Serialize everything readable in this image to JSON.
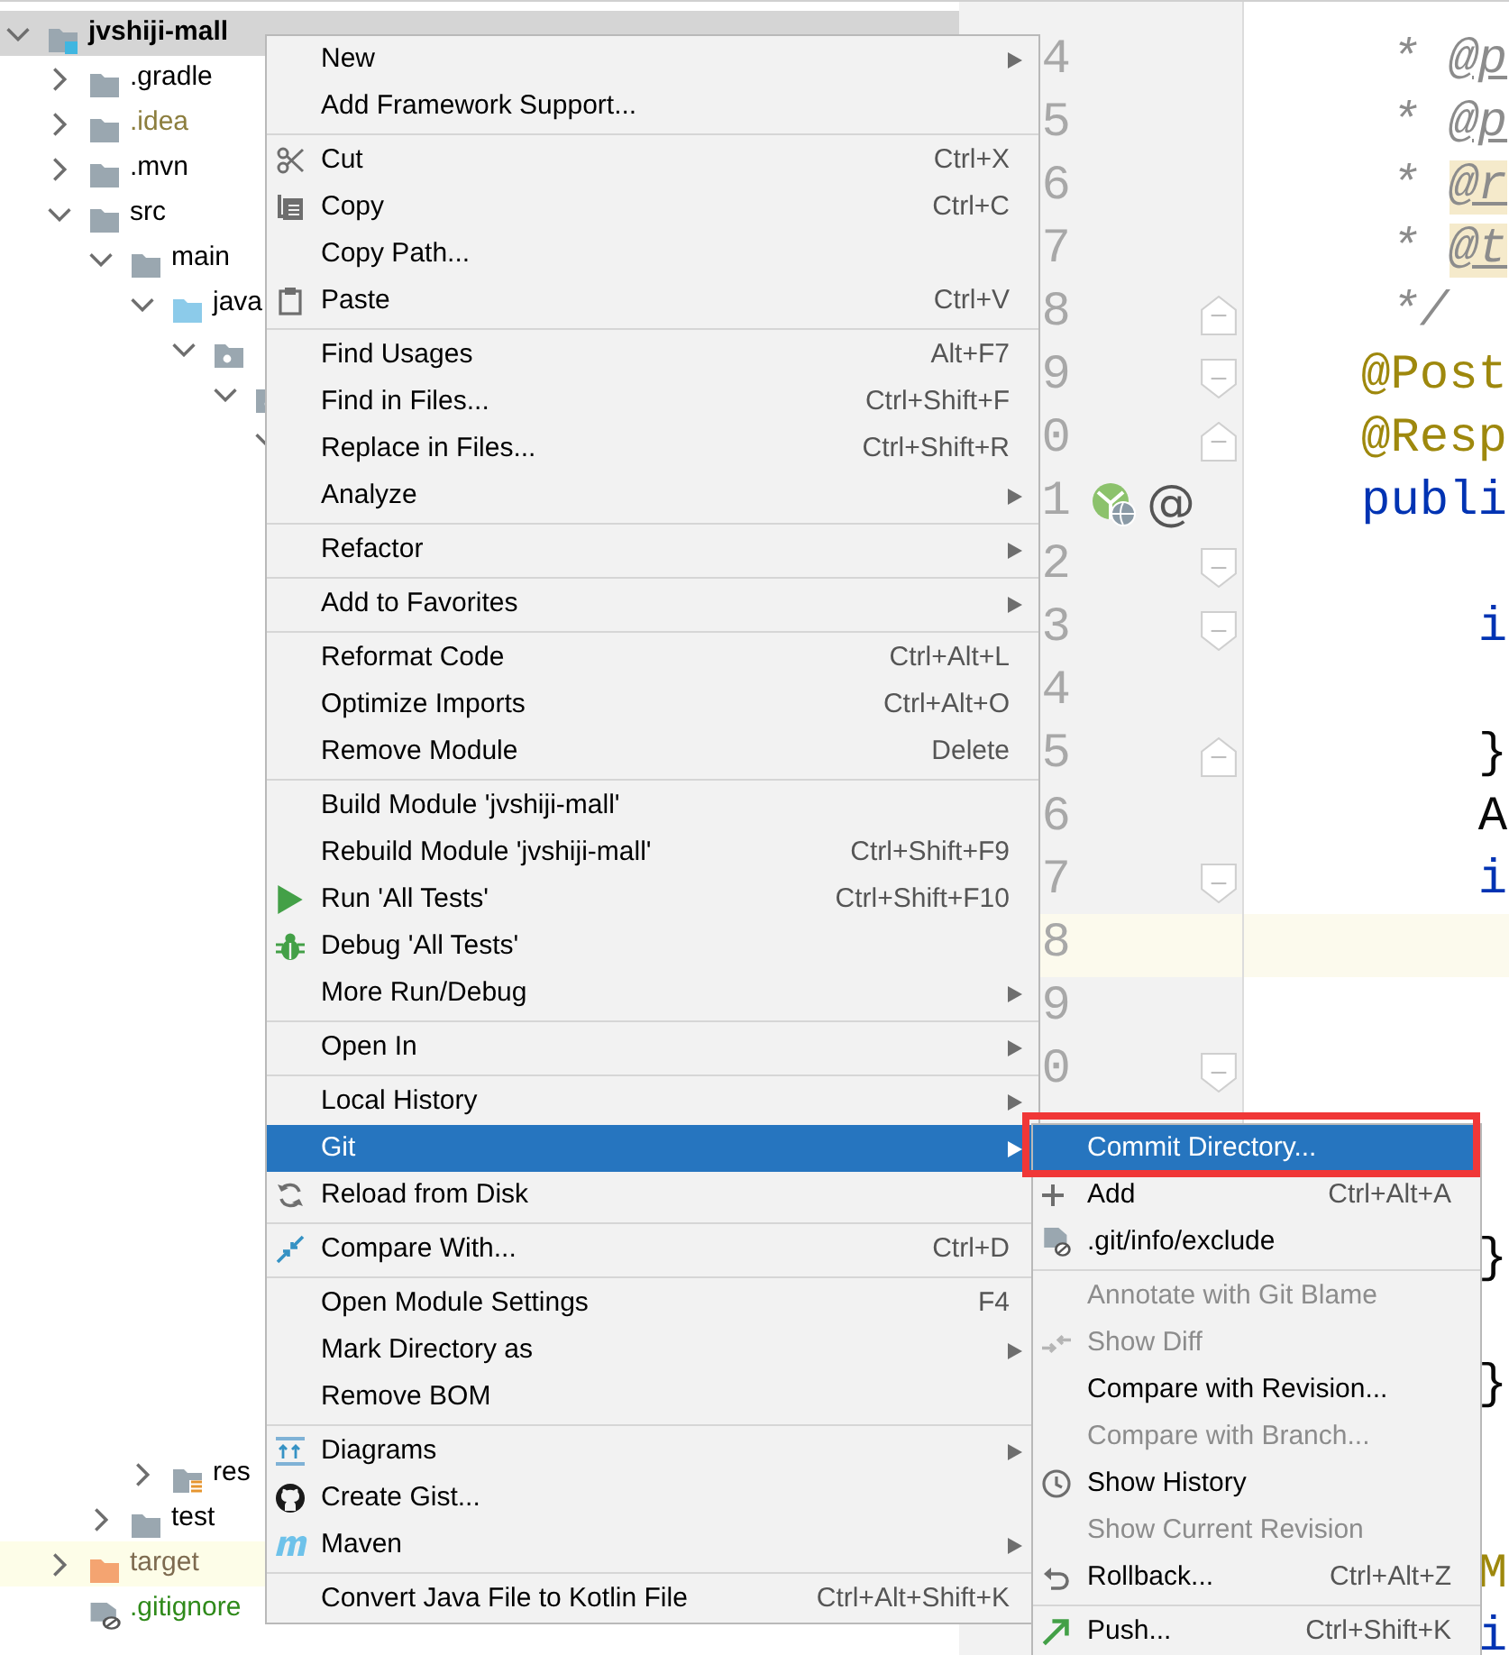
{
  "project_tree": {
    "root": {
      "label": "jvshiji-mall",
      "kind": "module",
      "expanded": true,
      "selected": true,
      "children": [
        {
          "label": ".gradle",
          "kind": "folder",
          "expanded": false
        },
        {
          "label": ".idea",
          "kind": "folder",
          "expanded": false,
          "color": "#8c7e3e"
        },
        {
          "label": ".mvn",
          "kind": "folder",
          "expanded": false
        },
        {
          "label": "src",
          "kind": "folder",
          "expanded": true,
          "children": [
            {
              "label": "main",
              "kind": "folder",
              "expanded": true,
              "children": [
                {
                  "label": "java",
                  "kind": "source",
                  "expanded": true,
                  "children": [
                    {
                      "kind": "package",
                      "expanded": true,
                      "children": [
                        {
                          "kind": "package",
                          "expanded": true,
                          "children": [
                            {
                              "expanded": true,
                              "more_rows_hidden": true
                            }
                          ]
                        }
                      ]
                    }
                  ]
                },
                {
                  "label": "res",
                  "kind": "resources",
                  "expanded": false
                }
              ]
            },
            {
              "label": "test",
              "kind": "folder",
              "expanded": false
            }
          ]
        },
        {
          "label": "target",
          "kind": "excluded",
          "expanded": false,
          "highlighted": true,
          "color": "#7d6a4f"
        },
        {
          "label": ".gitignore",
          "kind": "ignorefile",
          "color": "#2f8a1a"
        }
      ]
    }
  },
  "editor": {
    "lines": [
      {
        "number": "4",
        "kind": "plain",
        "segments": [
          {
            "text": " * ",
            "kind": "doc"
          },
          {
            "text": "@p",
            "kind": "doctag"
          }
        ]
      },
      {
        "number": "5",
        "kind": "plain",
        "segments": [
          {
            "text": " * ",
            "kind": "doc"
          },
          {
            "text": "@p",
            "kind": "doctag"
          }
        ]
      },
      {
        "number": "6",
        "kind": "plain",
        "segments": [
          {
            "text": " * ",
            "kind": "doc"
          },
          {
            "text": "@r",
            "kind": "doctag",
            "highlighted": true
          }
        ]
      },
      {
        "number": "7",
        "kind": "plain",
        "segments": [
          {
            "text": " * ",
            "kind": "doc"
          },
          {
            "text": "@t",
            "kind": "doctag",
            "highlighted": true
          }
        ]
      },
      {
        "number": "8",
        "kind": "foldend",
        "segments": [
          {
            "text": " */",
            "kind": "doc"
          }
        ]
      },
      {
        "number": "9",
        "kind": "foldstart",
        "segments": [
          {
            "text": "@Post",
            "kind": "annotation"
          }
        ]
      },
      {
        "number": "0",
        "kind": "foldend",
        "segments": [
          {
            "text": "@Resp",
            "kind": "annotation"
          }
        ]
      },
      {
        "number": "1",
        "kind": "method",
        "gutter_text": "@",
        "segments": [
          {
            "text": "publi",
            "kind": "keyword"
          }
        ]
      },
      {
        "number": "2",
        "kind": "foldstart"
      },
      {
        "number": "3",
        "kind": "foldstart",
        "segments": [
          {
            "text": "    i",
            "kind": "keyword"
          }
        ]
      },
      {
        "number": "4",
        "kind": "plain"
      },
      {
        "number": "5",
        "kind": "foldend",
        "segments": [
          {
            "text": "    }",
            "kind": "plain"
          }
        ]
      },
      {
        "number": "6",
        "kind": "plain",
        "segments": [
          {
            "text": "    A",
            "kind": "plain"
          }
        ]
      },
      {
        "number": "7",
        "kind": "foldstart",
        "segments": [
          {
            "text": "    i",
            "kind": "keyword"
          }
        ]
      },
      {
        "number": "8",
        "kind": "plain",
        "current": true
      },
      {
        "number": "9",
        "kind": "plain"
      },
      {
        "number": "0",
        "kind": "foldstart"
      },
      {
        "kind": "blank"
      },
      {
        "kind": "blank"
      },
      {
        "kind": "plain",
        "segments": [
          {
            "text": "    }",
            "kind": "plain"
          }
        ]
      },
      {
        "kind": "blank"
      },
      {
        "kind": "plain",
        "segments": [
          {
            "text": "    }",
            "kind": "plain"
          }
        ]
      },
      {
        "kind": "blank"
      },
      {
        "kind": "blank"
      },
      {
        "kind": "plain",
        "segments": [
          {
            "text": "    M",
            "kind": "annotation"
          }
        ]
      },
      {
        "kind": "plain",
        "segments": [
          {
            "text": "    i",
            "kind": "keyword"
          }
        ]
      }
    ]
  },
  "context_menu": {
    "items": [
      {
        "kind": "plain",
        "label": "New",
        "submenu": true,
        "selected": false
      },
      {
        "kind": "plain",
        "label": "Add Framework Support...",
        "selected": false
      },
      {
        "kind": "separator"
      },
      {
        "kind": "cut",
        "label": "Cut",
        "shortcut": "Ctrl+X",
        "selected": false
      },
      {
        "kind": "copy",
        "label": "Copy",
        "shortcut": "Ctrl+C",
        "selected": false
      },
      {
        "kind": "plain",
        "label": "Copy Path...",
        "selected": false
      },
      {
        "kind": "paste",
        "label": "Paste",
        "shortcut": "Ctrl+V",
        "selected": false
      },
      {
        "kind": "separator"
      },
      {
        "kind": "plain",
        "label": "Find Usages",
        "shortcut": "Alt+F7",
        "selected": false
      },
      {
        "kind": "plain",
        "label": "Find in Files...",
        "shortcut": "Ctrl+Shift+F",
        "selected": false
      },
      {
        "kind": "plain",
        "label": "Replace in Files...",
        "shortcut": "Ctrl+Shift+R",
        "selected": false
      },
      {
        "kind": "plain",
        "label": "Analyze",
        "submenu": true,
        "selected": false
      },
      {
        "kind": "separator"
      },
      {
        "kind": "plain",
        "label": "Refactor",
        "submenu": true,
        "selected": false
      },
      {
        "kind": "separator"
      },
      {
        "kind": "plain",
        "label": "Add to Favorites",
        "submenu": true,
        "selected": false
      },
      {
        "kind": "separator"
      },
      {
        "kind": "plain",
        "label": "Reformat Code",
        "shortcut": "Ctrl+Alt+L",
        "selected": false
      },
      {
        "kind": "plain",
        "label": "Optimize Imports",
        "shortcut": "Ctrl+Alt+O",
        "selected": false
      },
      {
        "kind": "plain",
        "label": "Remove Module",
        "shortcut": "Delete",
        "selected": false
      },
      {
        "kind": "separator"
      },
      {
        "kind": "plain",
        "label": "Build Module 'jvshiji-mall'",
        "selected": false
      },
      {
        "kind": "plain",
        "label": "Rebuild Module 'jvshiji-mall'",
        "shortcut": "Ctrl+Shift+F9",
        "selected": false
      },
      {
        "kind": "run",
        "label": "Run 'All Tests'",
        "shortcut": "Ctrl+Shift+F10",
        "selected": false
      },
      {
        "kind": "debug",
        "label": "Debug 'All Tests'",
        "selected": false
      },
      {
        "kind": "plain",
        "label": "More Run/Debug",
        "submenu": true,
        "selected": false
      },
      {
        "kind": "separator"
      },
      {
        "kind": "plain",
        "label": "Open In",
        "submenu": true,
        "selected": false
      },
      {
        "kind": "separator"
      },
      {
        "kind": "plain",
        "label": "Local History",
        "submenu": true,
        "selected": false
      },
      {
        "kind": "plain",
        "label": "Git",
        "submenu": true,
        "selected": true
      },
      {
        "kind": "reload",
        "label": "Reload from Disk",
        "selected": false
      },
      {
        "kind": "separator"
      },
      {
        "kind": "compare",
        "label": "Compare With...",
        "shortcut": "Ctrl+D",
        "selected": false
      },
      {
        "kind": "separator"
      },
      {
        "kind": "plain",
        "label": "Open Module Settings",
        "shortcut": "F4",
        "selected": false
      },
      {
        "kind": "plain",
        "label": "Mark Directory as",
        "submenu": true,
        "selected": false
      },
      {
        "kind": "plain",
        "label": "Remove BOM",
        "selected": false
      },
      {
        "kind": "separator"
      },
      {
        "kind": "diagram",
        "label": "Diagrams",
        "submenu": true,
        "selected": false
      },
      {
        "kind": "gist",
        "label": "Create Gist...",
        "selected": false
      },
      {
        "kind": "maven",
        "label": "Maven",
        "submenu": true,
        "selected": false
      },
      {
        "kind": "separator"
      },
      {
        "kind": "plain",
        "label": "Convert Java File to Kotlin File",
        "shortcut": "Ctrl+Alt+Shift+K",
        "selected": false
      }
    ]
  },
  "git_submenu": {
    "items": [
      {
        "kind": "plain",
        "label": "Commit Directory...",
        "selected": true,
        "disabled": false,
        "highlighted": true
      },
      {
        "kind": "add",
        "label": "Add",
        "shortcut": "Ctrl+Alt+A",
        "selected": false,
        "disabled": false
      },
      {
        "kind": "exclude",
        "label": ".git/info/exclude",
        "selected": false,
        "disabled": false
      },
      {
        "kind": "separator"
      },
      {
        "kind": "plain",
        "label": "Annotate with Git Blame",
        "selected": false,
        "disabled": true
      },
      {
        "kind": "diff",
        "label": "Show Diff",
        "selected": false,
        "disabled": true
      },
      {
        "kind": "plain",
        "label": "Compare with Revision...",
        "selected": false,
        "disabled": false
      },
      {
        "kind": "plain",
        "label": "Compare with Branch...",
        "selected": false,
        "disabled": true
      },
      {
        "kind": "history",
        "label": "Show History",
        "selected": false,
        "disabled": false
      },
      {
        "kind": "plain",
        "label": "Show Current Revision",
        "selected": false,
        "disabled": true
      },
      {
        "kind": "rollback",
        "label": "Rollback...",
        "shortcut": "Ctrl+Alt+Z",
        "selected": false,
        "disabled": false
      },
      {
        "kind": "separator"
      },
      {
        "kind": "push",
        "label": "Push...",
        "shortcut": "Ctrl+Shift+K",
        "selected": false,
        "disabled": false
      }
    ]
  }
}
